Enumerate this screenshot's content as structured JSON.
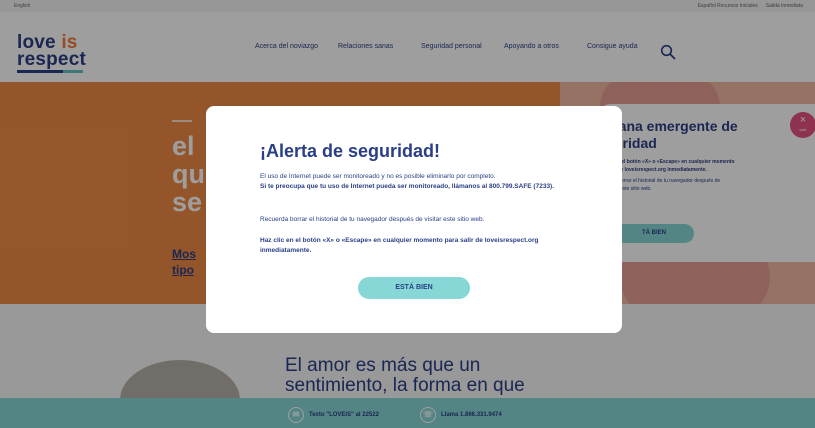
{
  "topbar": {
    "language": "English",
    "right_links": [
      "Español  Recursos  Iniciales",
      "Salida Inmediata"
    ]
  },
  "header": {
    "logo": {
      "word1": "love ",
      "word2": "is",
      "word3": "respect"
    },
    "nav": [
      {
        "label": "Acerca del noviazgo"
      },
      {
        "label": "Relaciones sanas"
      },
      {
        "label": "Seguridad personal"
      },
      {
        "label": "Apoyando a otros"
      },
      {
        "label": "Consigue ayuda"
      }
    ],
    "search_icon": "search-icon"
  },
  "hero": {
    "headline_fragment": "el\nqu\nse",
    "link_fragment": "Mos\ntipo",
    "card": {
      "title": "tana emergente de\nuridad",
      "body_bold": "en el botón «X» o «Escape» en cualquier momento\nr de loveisrespect.org inmediatamente.",
      "body": "a borrar el historial de tu navegador después de\nar este sitio web.",
      "button": "TÁ BIEN"
    },
    "corner_close": {
      "icon": "close-icon",
      "label": "×",
      "sublabel": "salir"
    }
  },
  "section2": {
    "title": "El amor es más que un\nsentimiento, la forma en que"
  },
  "footer": {
    "text_label": "Texto \"LOVEIS\" al 22522",
    "call_label": "Llama 1.866.331.9474",
    "text_icon": "chat-icon",
    "call_icon": "phone-icon"
  },
  "modal": {
    "title": "¡Alerta de seguridad!",
    "p1_normal": "El uso de Internet puede ser monitoreado y no es posible eliminarlo por completo.",
    "p1_bold": "Si te preocupa que tu uso de Internet pueda ser monitoreado, llámanos al 800.799.SAFE (7233).",
    "p2": "Recuerda borrar el historial de tu navegador después de visitar este sitio web.",
    "p3_bold": "Haz clic en el botón «X» o «Escape» en cualquier momento para salir de loveisrespect.org inmediatamente.",
    "button": "ESTÁ BIEN"
  },
  "colors": {
    "brand_navy": "#2a3f85",
    "accent_orange": "#f08a45",
    "accent_teal": "#86d7d5",
    "accent_pink": "#e55280"
  }
}
